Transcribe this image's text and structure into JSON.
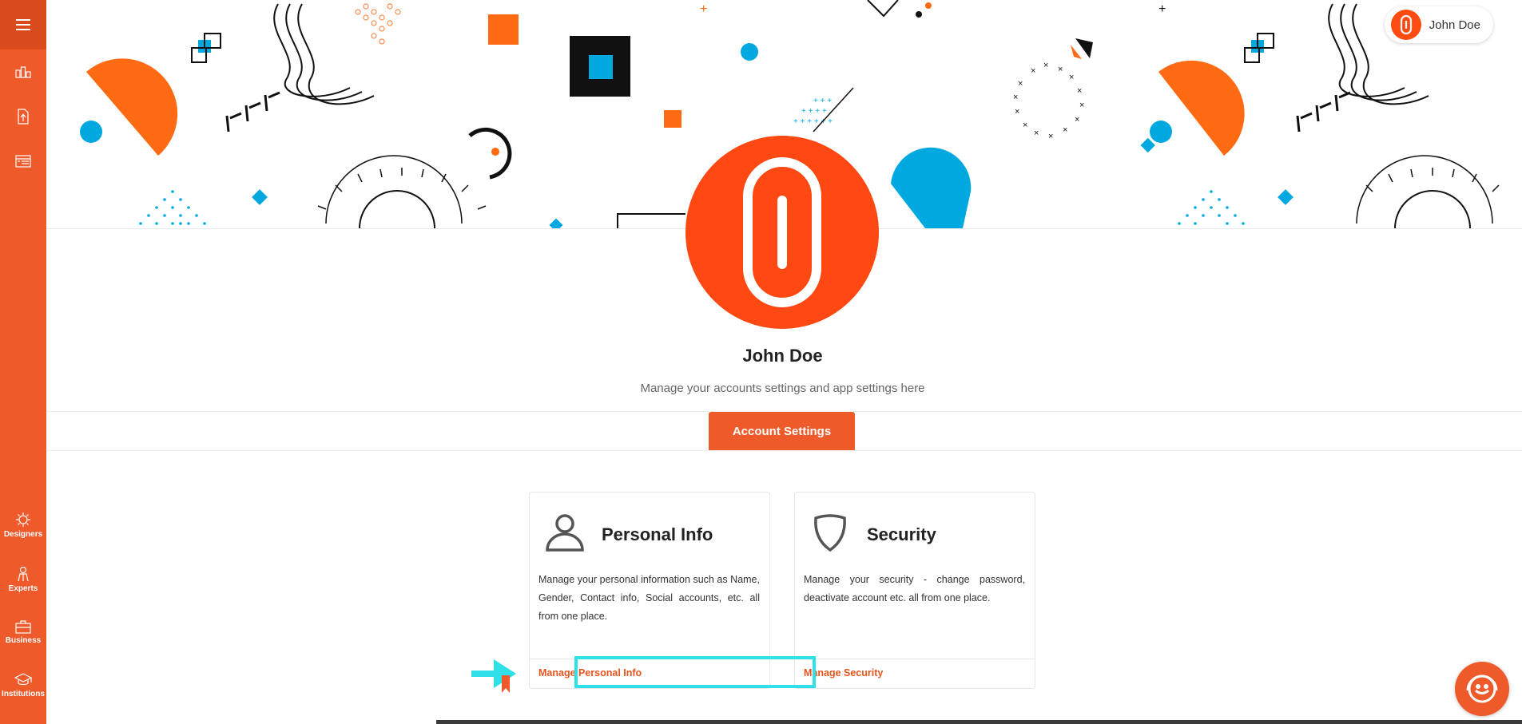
{
  "sidebar": {
    "menu_icon": "hamburger-icon",
    "top_icons": [
      "dashboard-icon",
      "document-icon",
      "list-icon"
    ],
    "items": [
      {
        "label": "Designers",
        "icon": "designer-icon"
      },
      {
        "label": "Experts",
        "icon": "expert-icon"
      },
      {
        "label": "Business",
        "icon": "briefcase-icon"
      },
      {
        "label": "Institutions",
        "icon": "graduation-cap-icon"
      }
    ]
  },
  "header": {
    "user_name": "John Doe",
    "avatar_icon": "paperclip-logo-icon"
  },
  "profile": {
    "name": "John Doe",
    "subtitle": "Manage your accounts settings and app settings here"
  },
  "tabs": [
    {
      "label": "Account Settings",
      "active": true
    }
  ],
  "cards": [
    {
      "title": "Personal Info",
      "icon": "user-icon",
      "description": "Manage your personal information such as Name, Gender, Contact info, Social accounts, etc. all from one place.",
      "link": "Manage Personal Info"
    },
    {
      "title": "Security",
      "icon": "shield-icon",
      "description": "Manage your security - change password, deactivate account etc. all from one place.",
      "link": "Manage Security"
    }
  ],
  "chat": {
    "icon": "support-chat-icon"
  },
  "colors": {
    "brand": "#ef5a2a",
    "brand_dark": "#d94a1c",
    "avatar": "#ff4812",
    "accent_blue": "#00a8e0",
    "highlight": "#2fe0e8"
  }
}
